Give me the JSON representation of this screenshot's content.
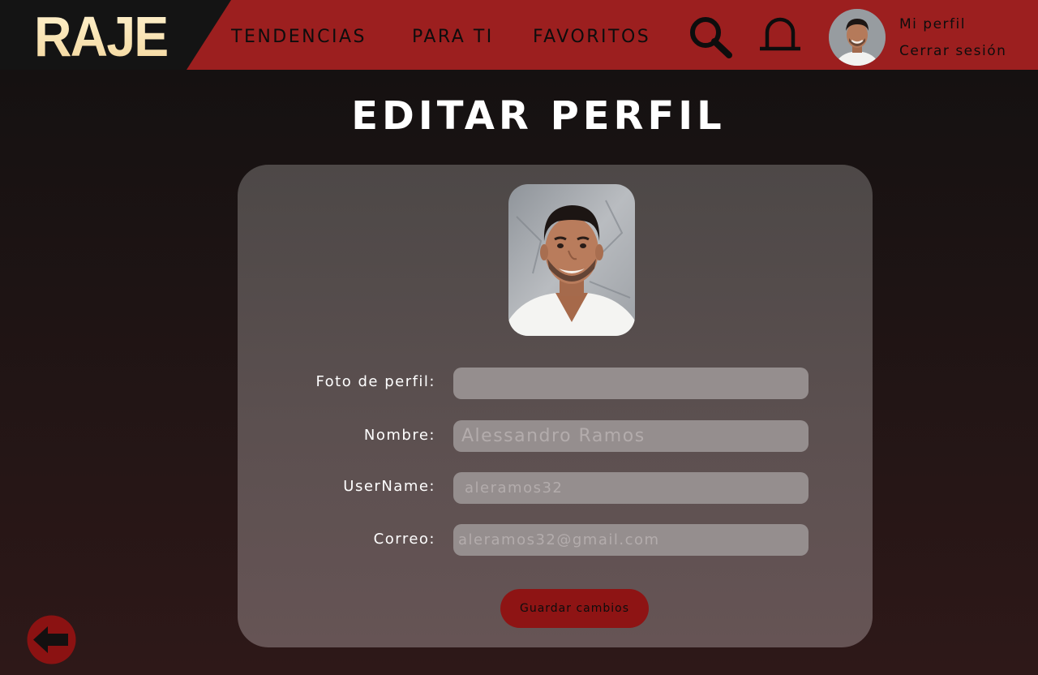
{
  "header": {
    "logo": "RAJE",
    "nav": [
      {
        "label": "TENDENCIAS"
      },
      {
        "label": "PARA TI"
      },
      {
        "label": "FAVORITOS"
      }
    ],
    "icons": {
      "search": "search-icon",
      "notifications": "bell-icon"
    },
    "user_menu": {
      "profile_label": "Mi perfil",
      "logout_label": "Cerrar sesión"
    }
  },
  "page": {
    "title": "EDITAR PERFIL"
  },
  "form": {
    "fields": [
      {
        "label": "Foto de perfil:",
        "value": "",
        "placeholder": ""
      },
      {
        "label": "Nombre:",
        "value": "",
        "placeholder": "Alessandro Ramos"
      },
      {
        "label": "UserName:",
        "value": "",
        "placeholder": "aleramos32"
      },
      {
        "label": "Correo:",
        "value": "",
        "placeholder": "aleramos32@gmail.com"
      }
    ],
    "save_label": "Guardar cambios"
  },
  "back": {
    "icon": "arrow-left-icon"
  },
  "colors": {
    "header_red": "#9c1f1f",
    "logo_cream": "#f6dfae",
    "button_red": "#8e1414",
    "back_red": "#8b1212",
    "card_gray": "#544d4d",
    "input_gray": "#958e8e"
  }
}
